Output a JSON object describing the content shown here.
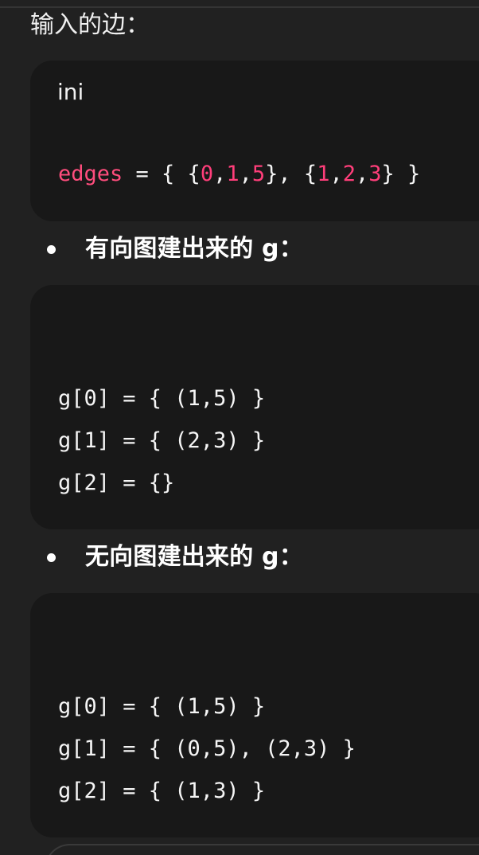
{
  "header": {
    "title": "输入的边："
  },
  "code_block_1": {
    "language": "ini",
    "edges_keyword": "edges",
    "edges_prefix": " = { {",
    "num_0": "0",
    "comma_1": ",",
    "num_1": "1",
    "comma_2": ",",
    "num_5": "5",
    "mid": "}, {",
    "num_1b": "1",
    "comma_3": ",",
    "num_2": "2",
    "comma_4": ",",
    "num_3": "3",
    "suffix": "} }"
  },
  "bullet_1": {
    "text": "有向图建出来的 g："
  },
  "code_block_2": {
    "lines": [
      "g[0] = { (1,5) }",
      "g[1] = { (2,3) }",
      "g[2] = {}"
    ]
  },
  "bullet_2": {
    "text": "无向图建出来的 g："
  },
  "code_block_3": {
    "lines": [
      "g[0] = { (1,5) }",
      "g[1] = { (0,5), (2,3) }",
      "g[2] = { (1,3) }"
    ]
  }
}
